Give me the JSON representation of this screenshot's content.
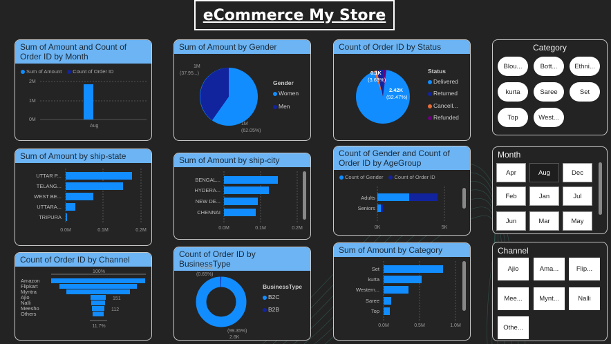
{
  "title": "eCommerce My Store",
  "colors": {
    "primary": "#118dff",
    "secondary": "#12239e",
    "orange": "#e66c37",
    "purple": "#6b007b",
    "header": "#6cb4f3"
  },
  "month_chart": {
    "title": "Sum of Amount and Count of Order ID by Month",
    "legend": [
      "Sum of Amount",
      "Count of Order ID"
    ],
    "yticks": [
      "2M",
      "1M",
      "0M"
    ],
    "xlabel": "Aug"
  },
  "gender_chart": {
    "title": "Sum of Amount by Gender",
    "legend_title": "Gender",
    "legend": [
      "Women",
      "Men"
    ],
    "label_men": "1M",
    "label_men_pct": "(37.95...)",
    "label_women": "1M",
    "label_women_pct": "(62.05%)"
  },
  "status_chart": {
    "title": "Count of Order ID by Status",
    "legend_title": "Status",
    "legend": [
      "Delivered",
      "Returned",
      "Cancell...",
      "Refunded"
    ],
    "label_small": "0.1K",
    "label_small_pct": "(3.63%)",
    "label_big": "2.42K",
    "label_big_pct": "(92.47%)"
  },
  "state_chart": {
    "title": "Sum of Amount by ship-state",
    "labels": [
      "UTTAR P...",
      "TELANG...",
      "WEST BE...",
      "UTTARA...",
      "TRIPURA"
    ],
    "xticks": [
      "0.0M",
      "0.1M",
      "0.2M"
    ]
  },
  "city_chart": {
    "title": "Sum of Amount by ship-city",
    "labels": [
      "BENGAL...",
      "HYDERA...",
      "NEW DE...",
      "CHENNAI"
    ],
    "xticks": [
      "0.0M",
      "0.1M",
      "0.2M"
    ]
  },
  "agegroup_chart": {
    "title": "Count of Gender and Count of Order ID by AgeGroup",
    "legend": [
      "Count of Gender",
      "Count of Order ID"
    ],
    "labels": [
      "Adults",
      "Seniors"
    ],
    "xticks": [
      "0K",
      "5K"
    ]
  },
  "channel_chart": {
    "title": "Count of Order ID by Channel",
    "labels": [
      "Amazon",
      "Flipkart",
      "Myntra",
      "Ajio",
      "Nalli",
      "Meesho",
      "Others"
    ],
    "top_label": "100%",
    "bottom_label": "11.7%",
    "value_ajio": "151",
    "value_meesho": "112"
  },
  "business_chart": {
    "title": "Count of Order ID by BusinessType",
    "legend_title": "BusinessType",
    "legend": [
      "B2C",
      "B2B"
    ],
    "label_small": "0.02K",
    "label_small_pct": "(0.65%)",
    "label_big": "2.6K",
    "label_big_pct": "(99.35%)"
  },
  "category_chart": {
    "title": "Sum of Amount by Category",
    "labels": [
      "Set",
      "kurta",
      "Western...",
      "Saree",
      "Top"
    ],
    "xticks": [
      "0.0M",
      "0.5M",
      "1.0M"
    ]
  },
  "category_slicer": {
    "title": "Category",
    "items": [
      "Blou...",
      "Bott...",
      "Ethni...",
      "kurta",
      "Saree",
      "Set",
      "Top",
      "West..."
    ]
  },
  "month_slicer": {
    "title": "Month",
    "items": [
      "Apr",
      "Aug",
      "Dec",
      "Feb",
      "Jan",
      "Jul",
      "Jun",
      "Mar",
      "May"
    ],
    "selected": "Aug"
  },
  "channel_slicer": {
    "title": "Channel",
    "items": [
      "Ajio",
      "Ama...",
      "Flip...",
      "Mee...",
      "Mynt...",
      "Nalli",
      "Othe..."
    ]
  }
}
